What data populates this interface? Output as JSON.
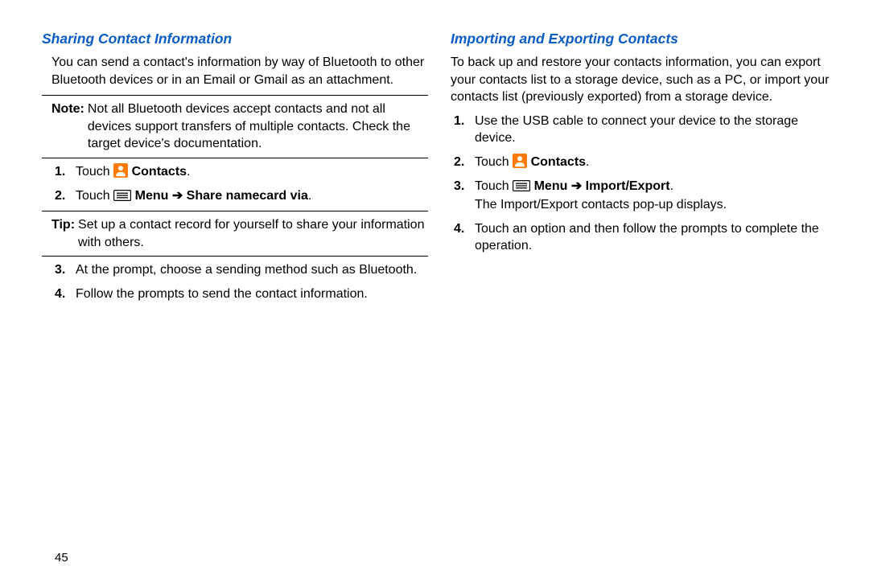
{
  "page_number": "45",
  "left": {
    "heading": "Sharing Contact Information",
    "intro": "You can send a contact's information by way of Bluetooth to other Bluetooth devices or in an Email or Gmail as an attachment.",
    "note_label": "Note:",
    "note_body": "Not all Bluetooth devices accept contacts and not all devices support transfers of multiple contacts. Check the target device's documentation.",
    "step1_touch": "Touch ",
    "contacts_word": "Contacts",
    "period": ".",
    "step2_touch": "Touch",
    "step2_menu": " Menu ",
    "step2_arrow": "➔",
    "step2_tail": " Share namecard via",
    "tip_label": "Tip:",
    "tip_body": "Set up a contact record for yourself to share your information with others.",
    "step3": "At the prompt, choose a sending method such as Bluetooth.",
    "step4": "Follow the prompts to send the contact information."
  },
  "right": {
    "heading": "Importing and Exporting Contacts",
    "intro": "To back up and restore your contacts information, you can export your contacts list to a storage device, such as a PC, or import your contacts list (previously exported) from a storage device.",
    "step1": "Use the USB cable to connect your device to the storage device.",
    "step2_touch": "Touch ",
    "contacts_word": "Contacts",
    "period": ".",
    "step3_touch": "Touch ",
    "step3_menu": " Menu ",
    "step3_arrow": "➔",
    "step3_tail": " Import/Export",
    "step3_sub": "The Import/Export contacts pop-up displays.",
    "step4": "Touch an option and then follow the prompts to complete the operation."
  }
}
